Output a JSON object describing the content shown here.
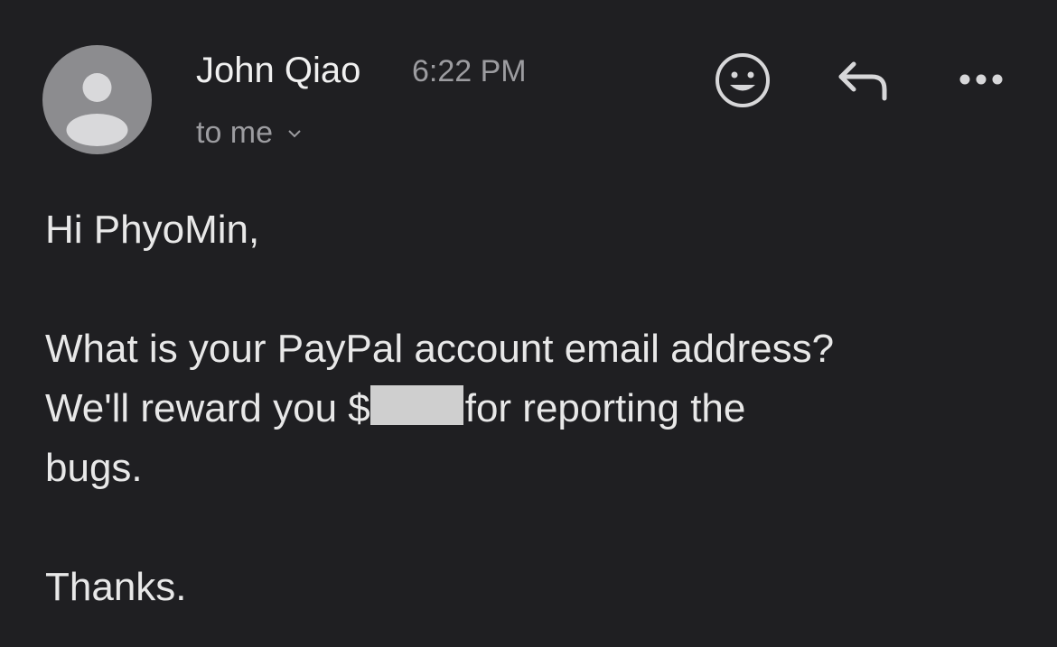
{
  "email": {
    "sender_name": "John Qiao",
    "time": "6:22 PM",
    "recipient_label": "to me",
    "avatar_icon": "default-user-avatar-icon",
    "actions": {
      "emoji_icon": "smiley-face-icon",
      "reply_icon": "reply-arrow-icon",
      "more_icon": "more-horizontal-icon"
    },
    "body": {
      "greeting": "Hi PhyoMin,",
      "line1": "What is your PayPal account email address?",
      "line2_before": "We'll reward you $",
      "line2_after": "for reporting the",
      "line3": "bugs.",
      "closing": "Thanks."
    }
  },
  "colors": {
    "background": "#1f1f22",
    "text_primary": "#e8e8e8",
    "text_secondary": "#9c9ca0",
    "avatar_bg": "#8c8c8f",
    "redaction": "#cfcfcf"
  }
}
